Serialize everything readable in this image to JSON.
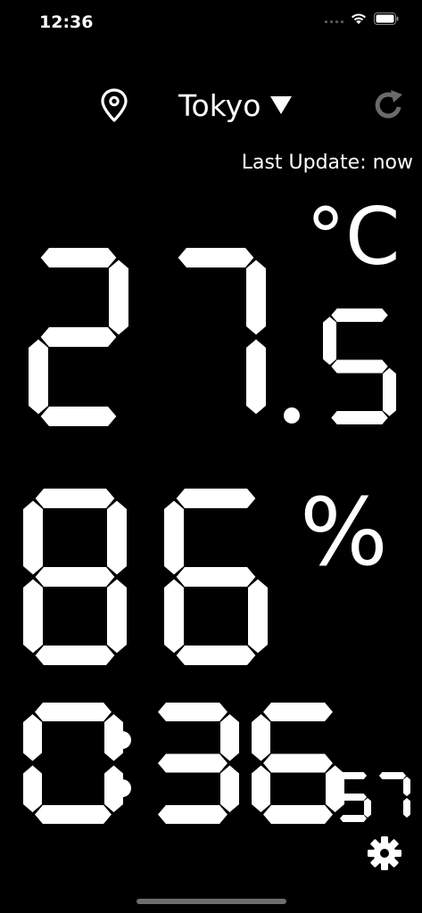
{
  "status_bar": {
    "time": "12:36"
  },
  "header": {
    "location_icon": "map-pin-icon",
    "city": "Tokyo",
    "dropdown_icon": "triangle-down-icon",
    "refresh_icon": "refresh-icon",
    "last_update": "Last Update: now"
  },
  "temperature": {
    "integer": "27",
    "decimal": "5",
    "unit": "°C"
  },
  "humidity": {
    "value": "86",
    "unit": "%"
  },
  "clock": {
    "hours": "0",
    "minutes": "36",
    "seconds": "57"
  },
  "footer": {
    "settings_icon": "gear-icon"
  }
}
